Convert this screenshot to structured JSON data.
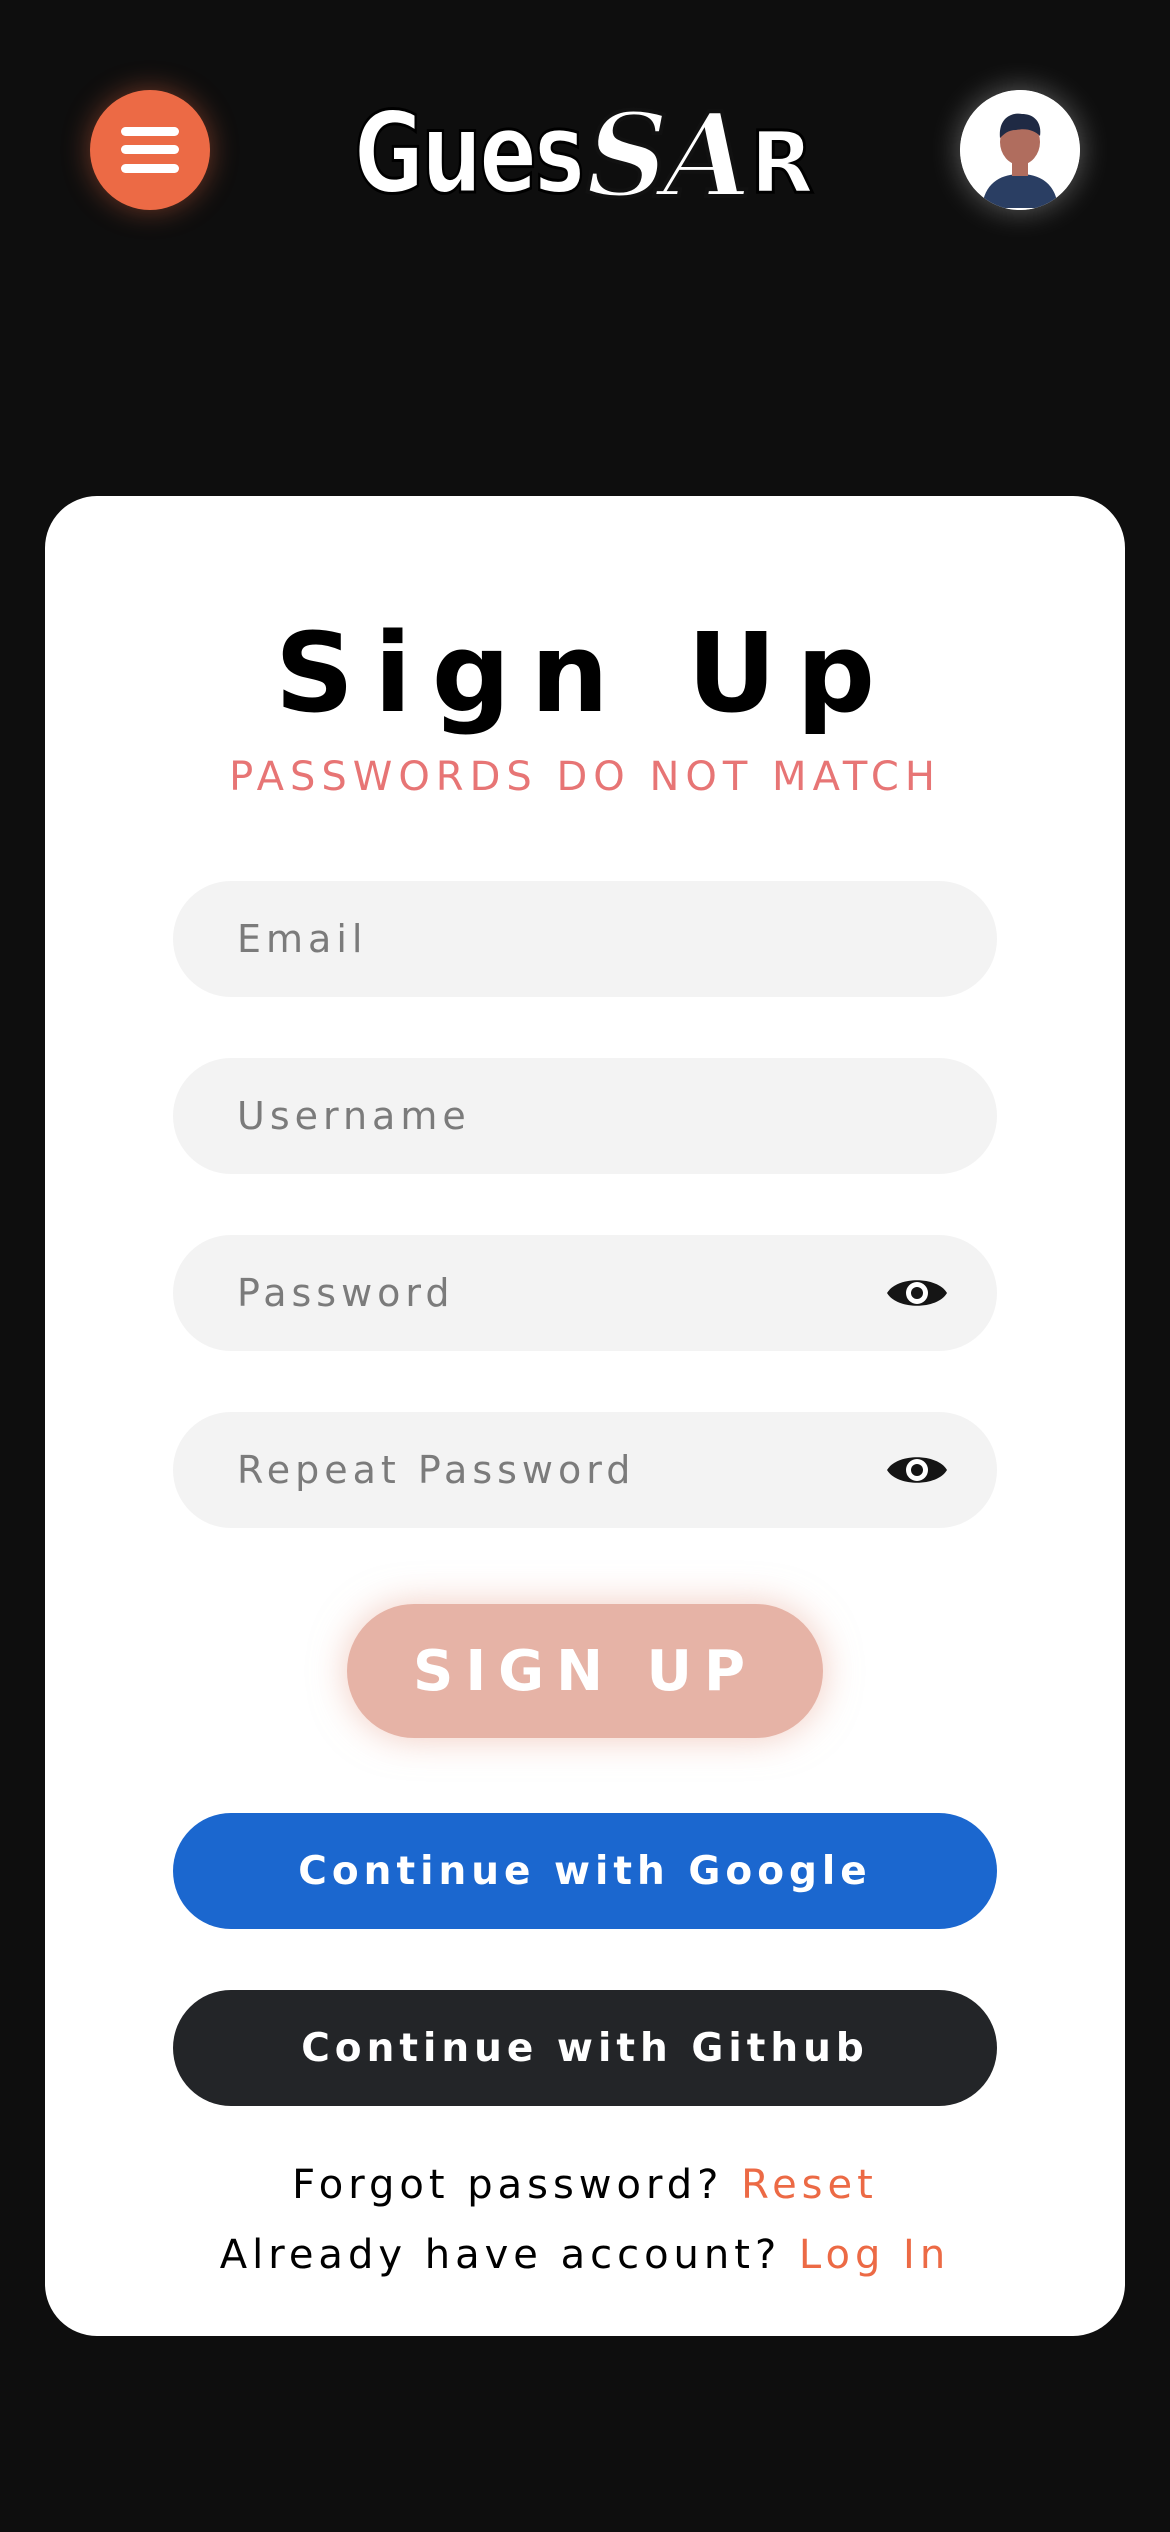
{
  "header": {
    "menu_icon": "hamburger-menu-icon",
    "logo_text": "GuesSAR",
    "avatar_icon": "user-avatar-icon",
    "accent_color": "#ec6a45"
  },
  "form": {
    "title": "Sign Up",
    "error_message": "PASSWORDS DO NOT MATCH",
    "error_color": "#e77575",
    "fields": {
      "email": {
        "placeholder": "Email",
        "value": ""
      },
      "username": {
        "placeholder": "Username",
        "value": ""
      },
      "password": {
        "placeholder": "Password",
        "value": "",
        "icon": "eye-icon"
      },
      "repeat_password": {
        "placeholder": "Repeat Password",
        "value": "",
        "icon": "eye-icon"
      }
    },
    "submit_label": "SIGN UP",
    "google_label": "Continue with Google",
    "github_label": "Continue with Github",
    "google_color": "#1b67cf",
    "github_color": "#232528"
  },
  "footer": {
    "forgot_text": "Forgot password?",
    "reset_link": "Reset",
    "have_account_text": "Already have account?",
    "login_link": "Log In"
  }
}
